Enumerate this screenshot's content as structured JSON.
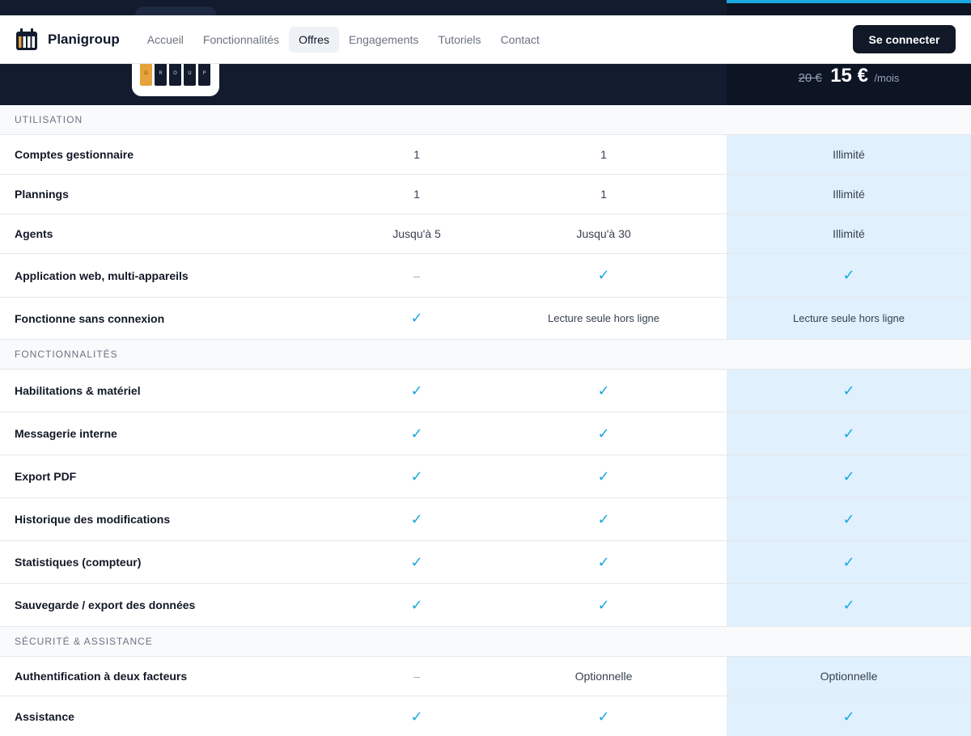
{
  "header": {
    "brand_name": "Planigroup",
    "nav": [
      {
        "label": "Accueil",
        "active": false
      },
      {
        "label": "Fonctionnalités",
        "active": false
      },
      {
        "label": "Offres",
        "active": true
      },
      {
        "label": "Engagements",
        "active": false
      },
      {
        "label": "Tutoriels",
        "active": false
      },
      {
        "label": "Contact",
        "active": false
      }
    ],
    "login_label": "Se connecter"
  },
  "logo": {
    "letters": [
      "G",
      "R",
      "O",
      "U",
      "P"
    ]
  },
  "pricing": {
    "old_price": "20 €",
    "new_price": "15 €",
    "period": "/mois"
  },
  "colors": {
    "accent": "#1ba7e0",
    "dark": "#131c2e",
    "highlight": "#e0f0fc"
  },
  "table": {
    "rows": [
      {
        "type": "section",
        "label": "UTILISATION"
      },
      {
        "type": "row",
        "label": "Comptes gestionnaire",
        "c1": "1",
        "c2": "1",
        "c3": "Illimité"
      },
      {
        "type": "row",
        "label": "Plannings",
        "c1": "1",
        "c2": "1",
        "c3": "Illimité"
      },
      {
        "type": "row",
        "label": "Agents",
        "c1": "Jusqu'à 5",
        "c2": "Jusqu'à 30",
        "c3": "Illimité"
      },
      {
        "type": "row",
        "label": "Application web, multi-appareils",
        "c1": "–",
        "c2": "✓",
        "c3": "✓"
      },
      {
        "type": "row",
        "label": "Fonctionne sans connexion",
        "c1": "✓",
        "c2": "Lecture seule hors ligne",
        "c3": "Lecture seule hors ligne"
      },
      {
        "type": "section",
        "label": "FONCTIONNALITÉS"
      },
      {
        "type": "row",
        "label": "Habilitations & matériel",
        "c1": "✓",
        "c2": "✓",
        "c3": "✓"
      },
      {
        "type": "row",
        "label": "Messagerie interne",
        "c1": "✓",
        "c2": "✓",
        "c3": "✓"
      },
      {
        "type": "row",
        "label": "Export PDF",
        "c1": "✓",
        "c2": "✓",
        "c3": "✓"
      },
      {
        "type": "row",
        "label": "Historique des modifications",
        "c1": "✓",
        "c2": "✓",
        "c3": "✓"
      },
      {
        "type": "row",
        "label": "Statistiques (compteur)",
        "c1": "✓",
        "c2": "✓",
        "c3": "✓"
      },
      {
        "type": "row",
        "label": "Sauvegarde / export des données",
        "c1": "✓",
        "c2": "✓",
        "c3": "✓"
      },
      {
        "type": "section",
        "label": "SÉCURITÉ & ASSISTANCE"
      },
      {
        "type": "row",
        "label": "Authentification à deux facteurs",
        "c1": "–",
        "c2": "Optionnelle",
        "c3": "Optionnelle"
      },
      {
        "type": "row",
        "label": "Assistance",
        "c1": "✓",
        "c2": "✓",
        "c3": "✓"
      }
    ]
  }
}
